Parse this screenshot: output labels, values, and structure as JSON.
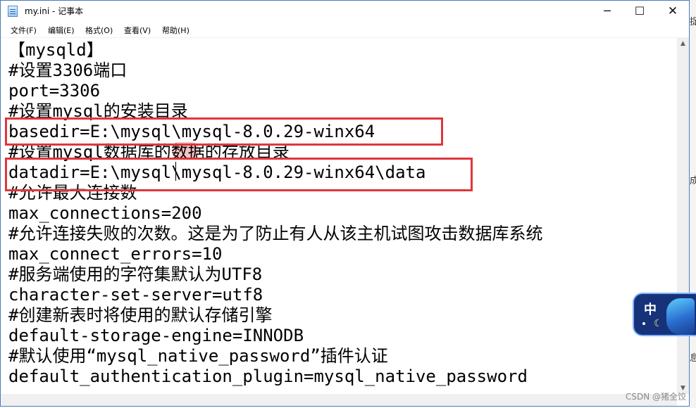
{
  "window": {
    "title": "my.ini - 记事本",
    "controls": {
      "minimize": "─",
      "maximize": "☐",
      "close": "✕"
    }
  },
  "menu": [
    "文件(F)",
    "编辑(E)",
    "格式(O)",
    "查看(V)",
    "帮助(H)"
  ],
  "content": {
    "lines": [
      "【mysqld】",
      "#设置3306端口",
      "port=3306",
      "#设置mysql的安装目录",
      "basedir=E:\\mysql\\mysql-8.0.29-winx64",
      "#设置mysql数据库的数据的存放目录",
      "datadir=E:\\mysql\\mysql-8.0.29-winx64\\data",
      "#允许最大连接数",
      "max_connections=200",
      "#允许连接失败的次数。这是为了防止有人从该主机试图攻击数据库系统",
      "max_connect_errors=10",
      "#服务端使用的字符集默认为UTF8",
      "character-set-server=utf8",
      "#创建新表时将使用的默认存储引擎",
      "default-storage-engine=INNODB",
      "#默认使用“mysql_native_password”插件认证",
      "default_authentication_plugin=mysql_native_password"
    ]
  },
  "highlight_color": "#e0363c",
  "ime": {
    "label": "中"
  },
  "background_edge": [
    "捉",
    "成",
    "息"
  ],
  "watermark": "CSDN @猪全饺"
}
